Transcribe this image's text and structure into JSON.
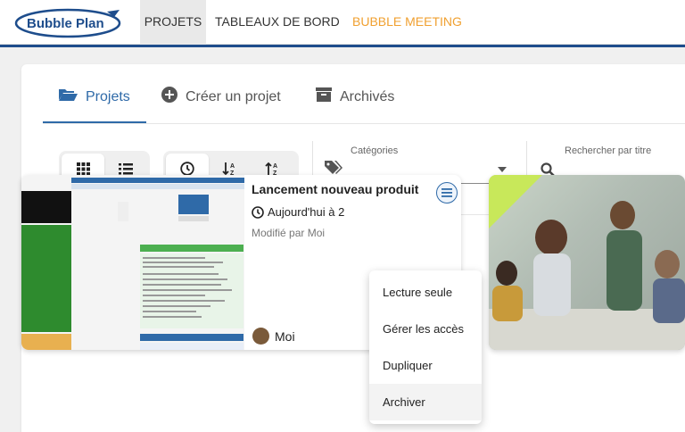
{
  "app": {
    "logo_text": "Bubble Plan"
  },
  "nav": {
    "projets": "PROJETS",
    "tableaux": "TABLEAUX DE BORD",
    "meeting": "BUBBLE MEETING"
  },
  "tabs": [
    {
      "label": "Projets",
      "icon": "folder-open-icon"
    },
    {
      "label": "Créer un projet",
      "icon": "plus-circle-icon"
    },
    {
      "label": "Archivés",
      "icon": "archive-icon"
    }
  ],
  "toolbar": {
    "categories_label": "Catégories",
    "categories_value": "",
    "search_label": "Rechercher par titre",
    "search_value": ""
  },
  "projects": [
    {
      "title": "Lancement nouveau produit",
      "date": "Aujourd'hui à 2",
      "modified": "Modifié par Moi",
      "owner": "Moi"
    }
  ],
  "menu": {
    "items": [
      "Lecture seule",
      "Gérer les accès",
      "Dupliquer",
      "Archiver"
    ]
  },
  "colors": {
    "accent": "#2f6aa8",
    "meeting": "#f0a030",
    "navy": "#1e4d8c"
  }
}
